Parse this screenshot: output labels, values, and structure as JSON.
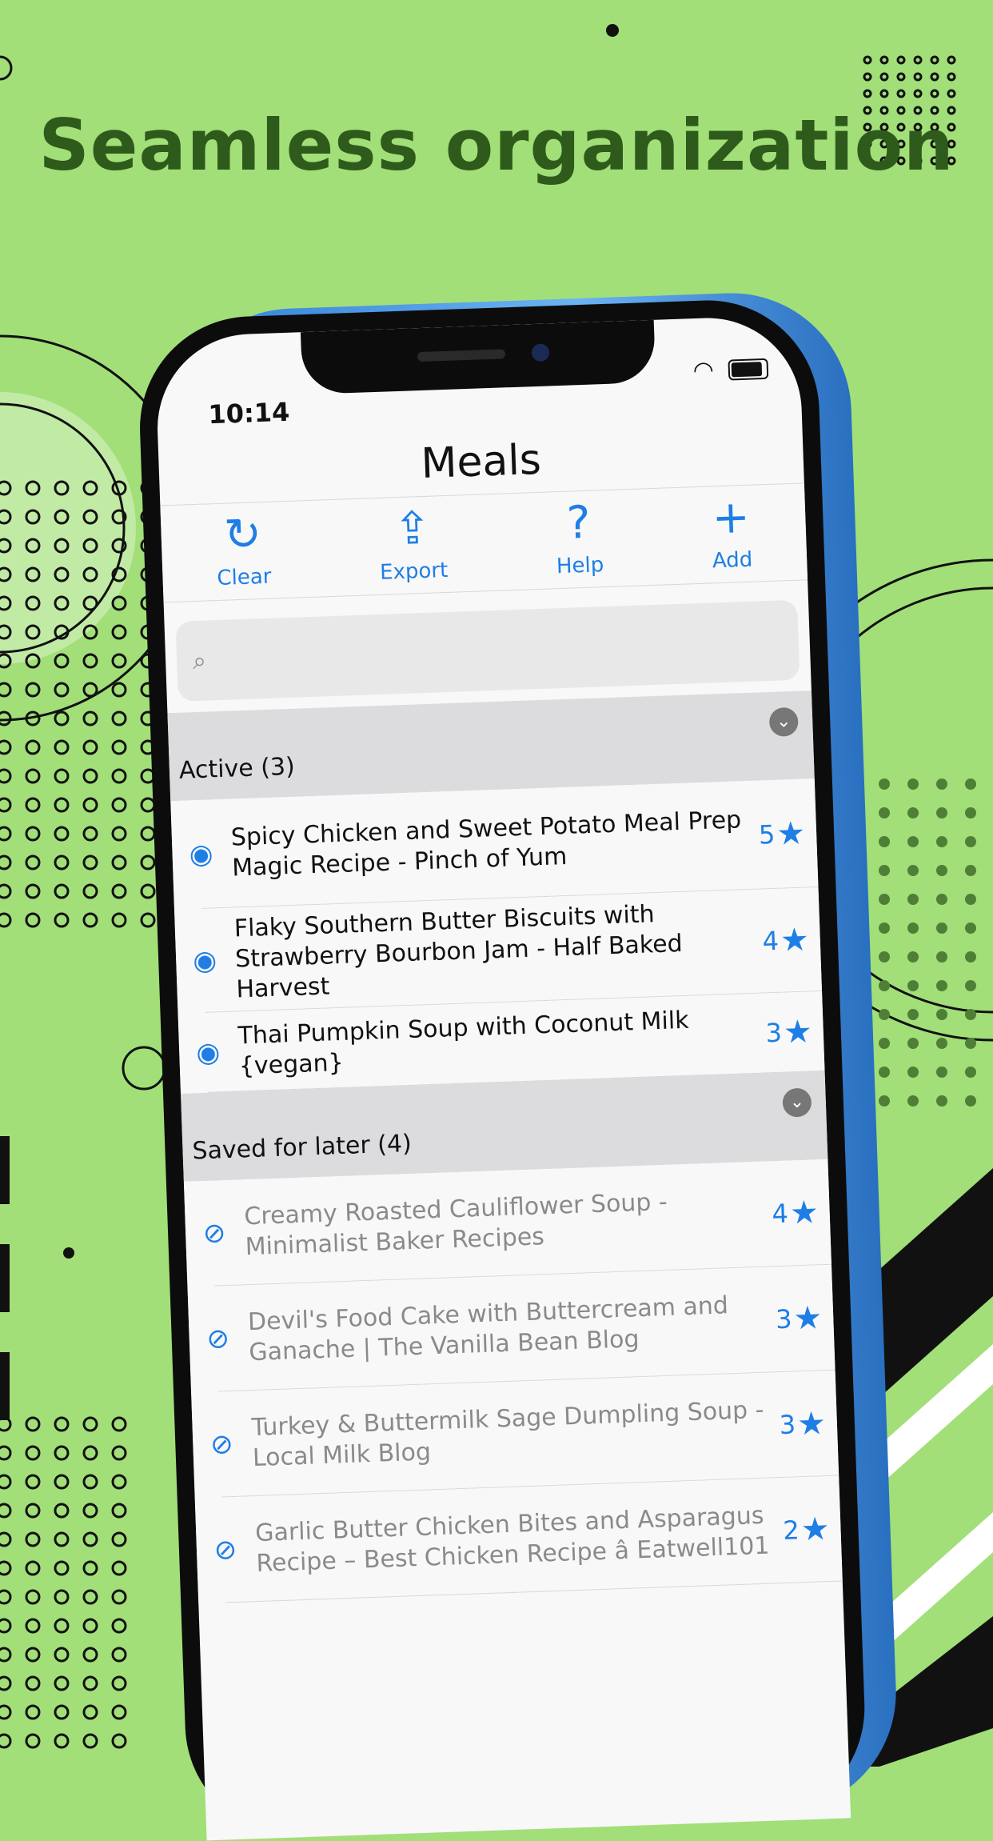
{
  "headline": "Seamless organization",
  "status": {
    "time": "10:14"
  },
  "nav": {
    "title": "Meals"
  },
  "toolbar": [
    {
      "label": "Clear",
      "icon": "refresh-icon"
    },
    {
      "label": "Export",
      "icon": "share-icon"
    },
    {
      "label": "Help",
      "icon": "question-icon"
    },
    {
      "label": "Add",
      "icon": "plus-icon"
    }
  ],
  "search": {
    "placeholder": ""
  },
  "sections": [
    {
      "title": "Active (3)",
      "items": [
        {
          "title": "Spicy Chicken and Sweet Potato Meal Prep Magic Recipe - Pinch of Yum",
          "rating": "5",
          "visible": true
        },
        {
          "title": "Flaky Southern Butter Biscuits with Strawberry Bourbon Jam - Half Baked Harvest",
          "rating": "4",
          "visible": true
        },
        {
          "title": "Thai Pumpkin Soup with Coconut Milk {vegan}",
          "rating": "3",
          "visible": true
        }
      ]
    },
    {
      "title": "Saved for later (4)",
      "items": [
        {
          "title": "Creamy Roasted Cauliflower Soup - Minimalist Baker Recipes",
          "rating": "4",
          "visible": false
        },
        {
          "title": "Devil's Food Cake with Buttercream and Ganache | The Vanilla Bean Blog",
          "rating": "3",
          "visible": false
        },
        {
          "title": "Turkey & Buttermilk Sage Dumpling Soup - Local Milk Blog",
          "rating": "3",
          "visible": false
        },
        {
          "title": "Garlic Butter Chicken Bites and Asparagus Recipe – Best Chicken Recipe â Eatwell101",
          "rating": "2",
          "visible": false
        }
      ]
    }
  ],
  "colors": {
    "background": "#a2df78",
    "headline": "#2e5b1c",
    "accent": "#1e7ee6"
  }
}
